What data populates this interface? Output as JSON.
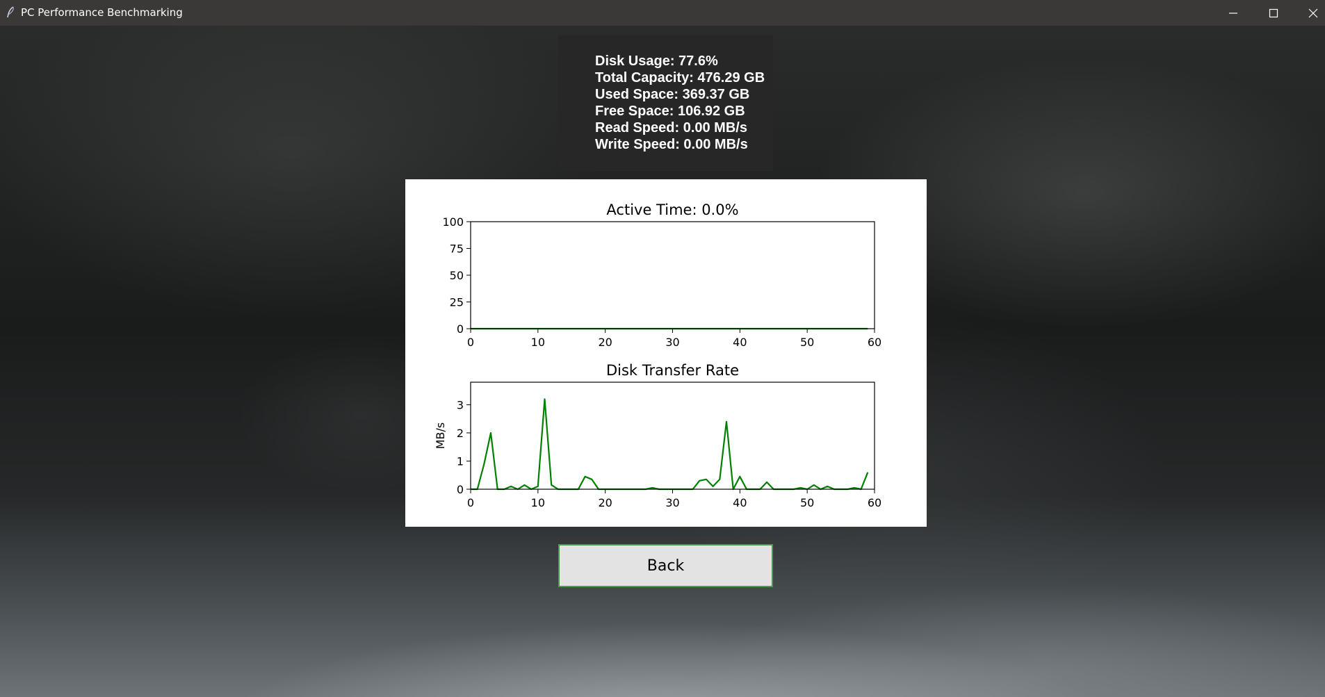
{
  "window": {
    "title": "PC Performance Benchmarking",
    "app_icon": "feather-icon",
    "controls": [
      "minimize-icon",
      "maximize-icon",
      "close-icon"
    ]
  },
  "info": {
    "disk_usage": "Disk Usage: 77.6%",
    "total_capacity": "Total Capacity: 476.29 GB",
    "used_space": "Used Space: 369.37 GB",
    "free_space": "Free Space: 106.92 GB",
    "read_speed": "Read Speed: 0.00 MB/s",
    "write_speed": "Write Speed: 0.00 MB/s"
  },
  "back_button": {
    "label": "Back"
  },
  "colors": {
    "line": "#008000",
    "button_border": "#4c9a4c",
    "panel_bg": "#272727"
  },
  "chart_data": [
    {
      "type": "line",
      "title": "Active Time: 0.0%",
      "xlabel": "",
      "ylabel": "",
      "xlim": [
        0,
        60
      ],
      "ylim": [
        0,
        100
      ],
      "xticks": [
        0,
        10,
        20,
        30,
        40,
        50,
        60
      ],
      "yticks": [
        0,
        25,
        50,
        75,
        100
      ],
      "grid": false,
      "series": [
        {
          "color": "#008000",
          "x": [
            0,
            1,
            2,
            3,
            4,
            5,
            6,
            7,
            8,
            9,
            10,
            11,
            12,
            13,
            14,
            15,
            16,
            17,
            18,
            19,
            20,
            21,
            22,
            23,
            24,
            25,
            26,
            27,
            28,
            29,
            30,
            31,
            32,
            33,
            34,
            35,
            36,
            37,
            38,
            39,
            40,
            41,
            42,
            43,
            44,
            45,
            46,
            47,
            48,
            49,
            50,
            51,
            52,
            53,
            54,
            55,
            56,
            57,
            58,
            59
          ],
          "values": [
            0,
            0,
            0,
            0,
            0,
            0,
            0,
            0,
            0,
            0,
            0,
            0,
            0,
            0,
            0,
            0,
            0,
            0,
            0,
            0,
            0,
            0,
            0,
            0,
            0,
            0,
            0,
            0,
            0,
            0,
            0,
            0,
            0,
            0,
            0,
            0,
            0,
            0,
            0,
            0,
            0,
            0,
            0,
            0,
            0,
            0,
            0,
            0,
            0,
            0,
            0,
            0,
            0,
            0,
            0,
            0,
            0,
            0,
            0,
            0
          ]
        }
      ]
    },
    {
      "type": "line",
      "title": "Disk Transfer Rate",
      "xlabel": "",
      "ylabel": "MB/s",
      "xlim": [
        0,
        60
      ],
      "ylim": [
        0,
        3.8
      ],
      "xticks": [
        0,
        10,
        20,
        30,
        40,
        50,
        60
      ],
      "yticks": [
        0,
        1,
        2,
        3
      ],
      "grid": false,
      "series": [
        {
          "color": "#008000",
          "x": [
            0,
            1,
            2,
            3,
            4,
            5,
            6,
            7,
            8,
            9,
            10,
            11,
            12,
            13,
            14,
            15,
            16,
            17,
            18,
            19,
            20,
            21,
            22,
            23,
            24,
            25,
            26,
            27,
            28,
            29,
            30,
            31,
            32,
            33,
            34,
            35,
            36,
            37,
            38,
            39,
            40,
            41,
            42,
            43,
            44,
            45,
            46,
            47,
            48,
            49,
            50,
            51,
            52,
            53,
            54,
            55,
            56,
            57,
            58,
            59
          ],
          "values": [
            0,
            0,
            0.9,
            2.0,
            0,
            0,
            0.1,
            0,
            0.15,
            0,
            0.1,
            3.2,
            0.15,
            0,
            0,
            0,
            0,
            0.45,
            0.35,
            0,
            0,
            0,
            0,
            0,
            0,
            0,
            0,
            0.05,
            0,
            0,
            0,
            0,
            0,
            0,
            0.3,
            0.35,
            0.1,
            0.35,
            2.4,
            0,
            0.45,
            0,
            0,
            0,
            0.25,
            0,
            0,
            0,
            0,
            0.05,
            0,
            0.15,
            0,
            0.1,
            0,
            0,
            0,
            0.05,
            0,
            0.6
          ]
        }
      ]
    }
  ]
}
